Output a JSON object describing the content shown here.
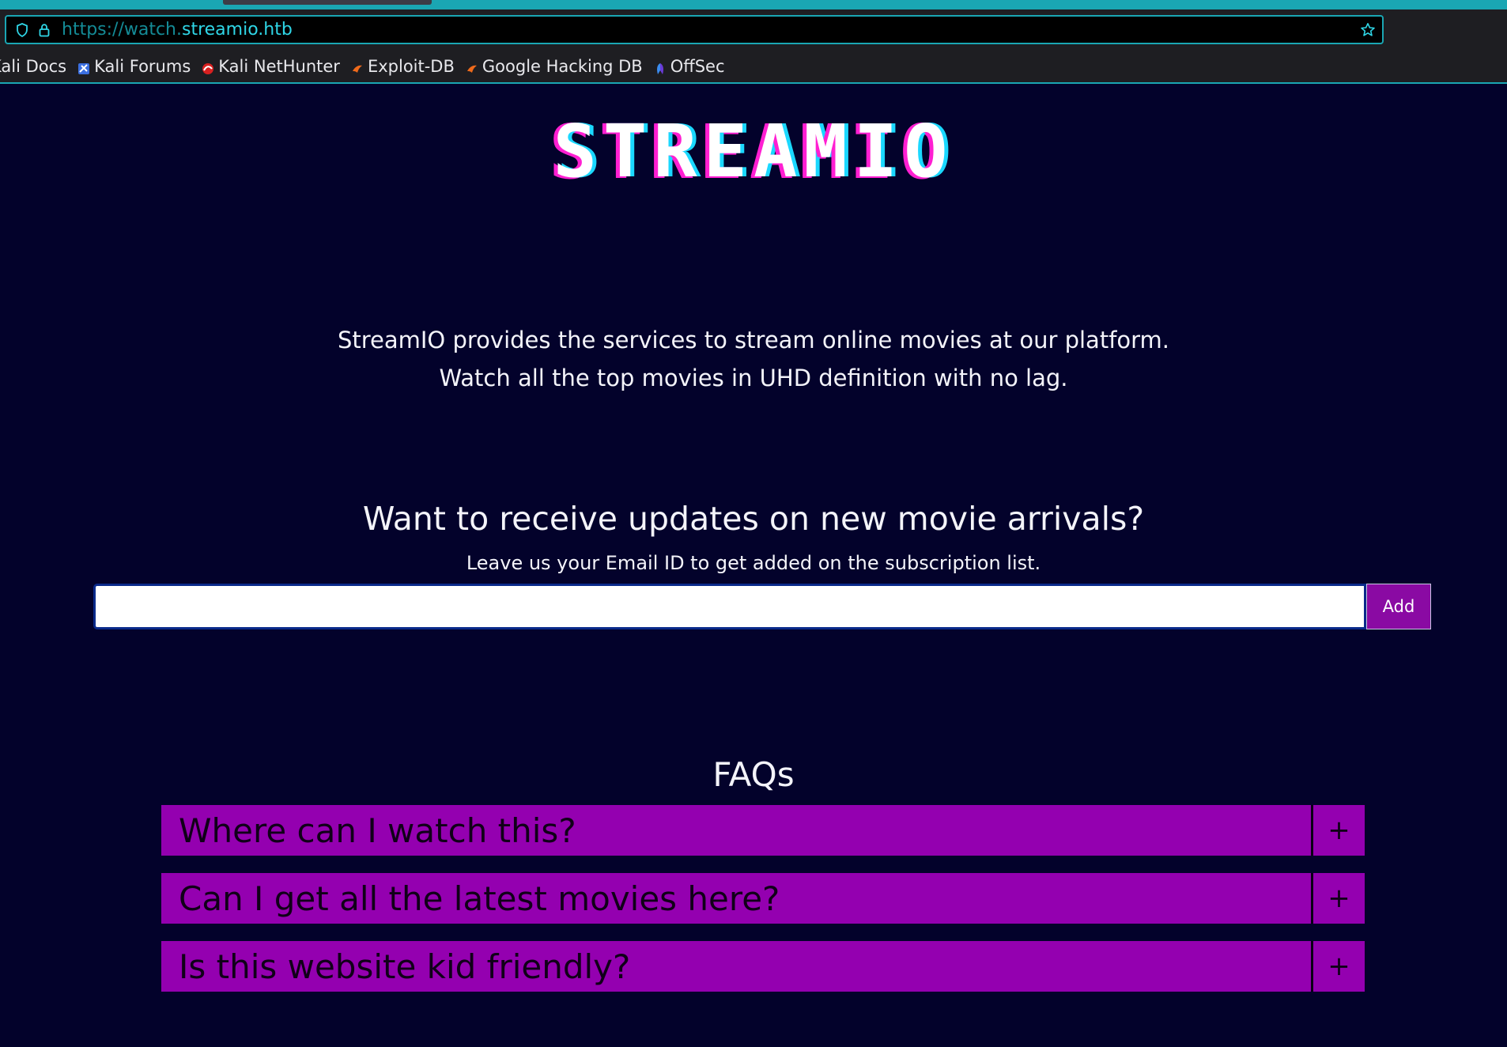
{
  "browser": {
    "url_prefix": "https://watch.",
    "url_host": "streamio.htb",
    "bookmarks": [
      {
        "label": "Kali Docs",
        "icon": "kali-docs-icon"
      },
      {
        "label": "Kali Forums",
        "icon": "kali-forums-icon"
      },
      {
        "label": "Kali NetHunter",
        "icon": "kali-nethunter-icon"
      },
      {
        "label": "Exploit-DB",
        "icon": "exploit-db-icon"
      },
      {
        "label": "Google Hacking DB",
        "icon": "google-hacking-db-icon"
      },
      {
        "label": "OffSec",
        "icon": "offsec-icon"
      }
    ]
  },
  "page": {
    "logo": "STREAMIO",
    "intro_line1": "StreamIO provides the services to stream online movies at our platform.",
    "intro_line2": "Watch all the top movies in UHD definition with no lag.",
    "subscribe": {
      "title": "Want to receive updates on new movie arrivals?",
      "subtitle": "Leave us your Email ID to get added on the subscription list.",
      "email_value": "",
      "button_label": "Add"
    },
    "faq": {
      "title": "FAQs",
      "items": [
        {
          "question": "Where can I watch this?",
          "toggle": "+"
        },
        {
          "question": "Can I get all the latest movies here?",
          "toggle": "+"
        },
        {
          "question": "Is this website kid friendly?",
          "toggle": "+"
        }
      ]
    }
  },
  "colors": {
    "page_bg": "#03022b",
    "accent": "#9400b0",
    "browser_accent": "#1aa6b3"
  }
}
